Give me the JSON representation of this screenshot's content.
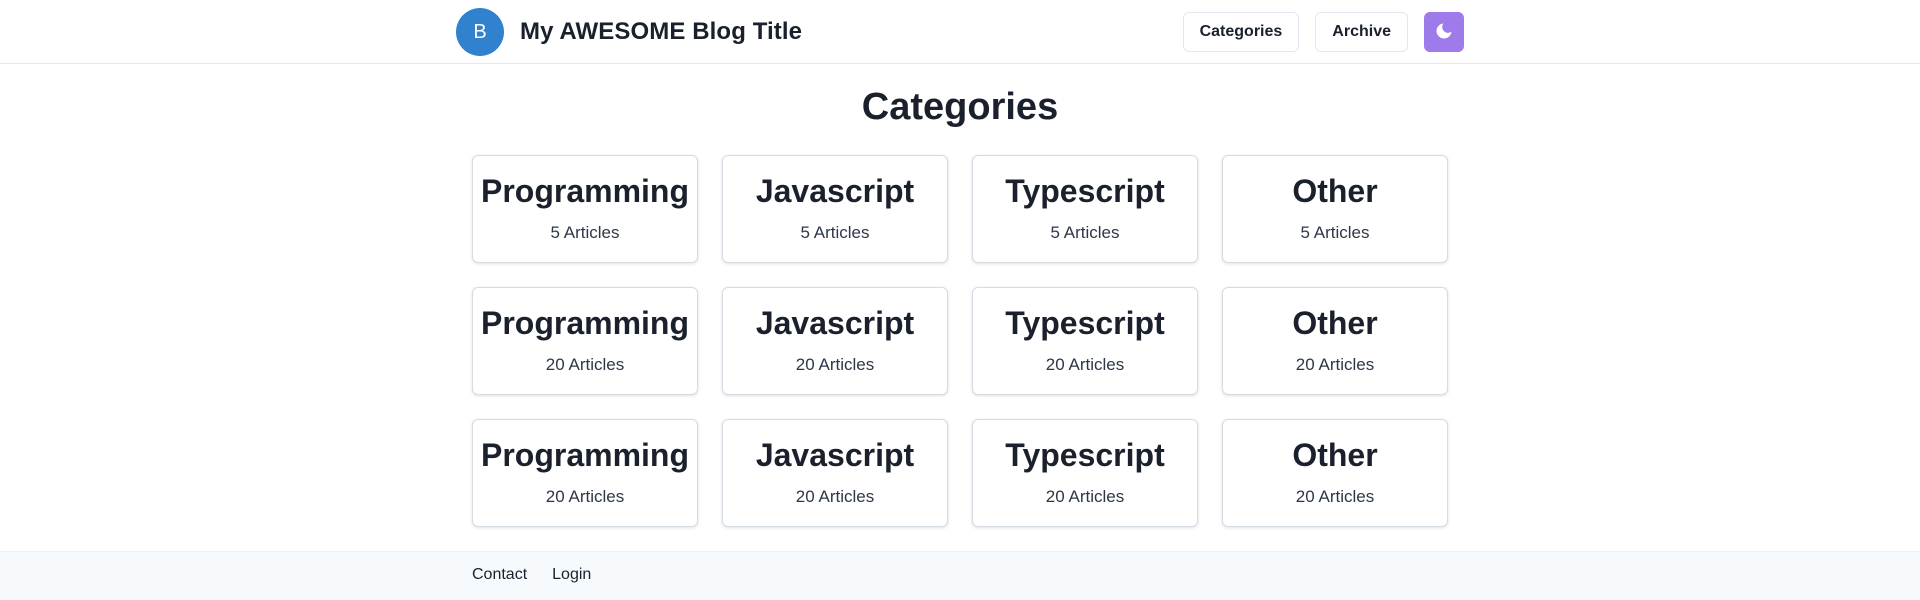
{
  "header": {
    "avatar_initial": "B",
    "blog_title": "My AWESOME Blog Title",
    "nav": {
      "categories_label": "Categories",
      "archive_label": "Archive"
    },
    "theme_toggle_icon": "moon-icon",
    "theme_toggle_color": "#9f7aea"
  },
  "main": {
    "page_title": "Categories",
    "categories": [
      {
        "name": "Programming",
        "count": "5 Articles"
      },
      {
        "name": "Javascript",
        "count": "5 Articles"
      },
      {
        "name": "Typescript",
        "count": "5 Articles"
      },
      {
        "name": "Other",
        "count": "5 Articles"
      },
      {
        "name": "Programming",
        "count": "20 Articles"
      },
      {
        "name": "Javascript",
        "count": "20 Articles"
      },
      {
        "name": "Typescript",
        "count": "20 Articles"
      },
      {
        "name": "Other",
        "count": "20 Articles"
      },
      {
        "name": "Programming",
        "count": "20 Articles"
      },
      {
        "name": "Javascript",
        "count": "20 Articles"
      },
      {
        "name": "Typescript",
        "count": "20 Articles"
      },
      {
        "name": "Other",
        "count": "20 Articles"
      }
    ]
  },
  "footer": {
    "links": [
      {
        "label": "Contact"
      },
      {
        "label": "Login"
      }
    ]
  },
  "colors": {
    "avatar": "#3182ce",
    "accent": "#9f7aea",
    "footer_bg": "#f7fafc"
  }
}
